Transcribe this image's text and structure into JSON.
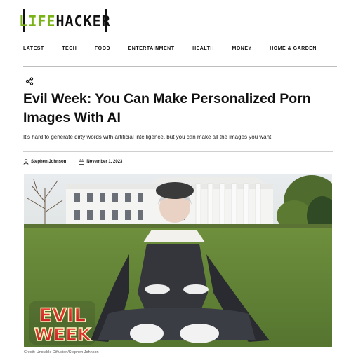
{
  "brand": {
    "logo_part1": "LIFE",
    "logo_part2": "HACKER"
  },
  "nav": [
    "LATEST",
    "TECH",
    "FOOD",
    "ENTERTAINMENT",
    "HEALTH",
    "MONEY",
    "HOME & GARDEN"
  ],
  "article": {
    "headline": "Evil Week: You Can Make Personalized Porn Images With AI",
    "dek": "It's hard to generate dirty words with artificial intelligence, but you can make all the images you want.",
    "author": "Stephen Johnson",
    "date": "November 1, 2023",
    "image_badge_line1": "EVIL",
    "image_badge_line2": "WEEK",
    "caption": "Credit: Unstable Diffusion/Stephen Johnson"
  },
  "colors": {
    "brand_green": "#7ab317",
    "text": "#111111",
    "divider": "#bdbdbd",
    "badge_red": "#e0242b"
  },
  "icons": {
    "share": "share-icon",
    "author": "user-icon",
    "date": "calendar-icon"
  }
}
